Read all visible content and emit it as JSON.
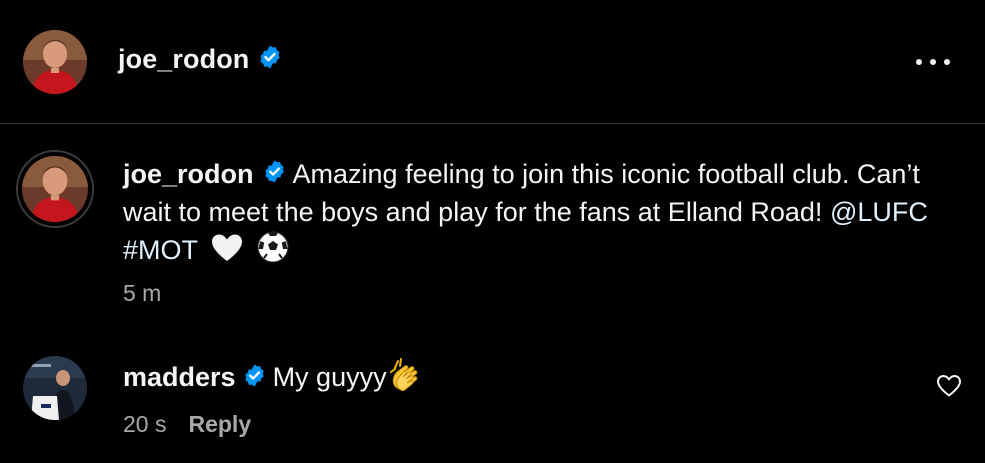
{
  "header": {
    "username": "joe_rodon",
    "avatar": "profile-photo-red-kit",
    "more_icon": "more-horizontal-icon"
  },
  "post": {
    "username": "joe_rodon",
    "caption_text": "Amazing feeling to join this iconic football club. Can’t wait to meet the boys and play for the fans at Elland Road!",
    "mention": "@LUFC",
    "hashtag": "#MOT",
    "emojis": [
      "white-heart-emoji",
      "soccer-ball-emoji"
    ],
    "timestamp": "5 m"
  },
  "comment": {
    "username": "madders",
    "text": "My guyyy",
    "emoji": "clapping-hands-emoji",
    "timestamp": "20 s",
    "reply_label": "Reply",
    "like_icon": "heart-outline-icon"
  },
  "colors": {
    "background": "#000000",
    "text_primary": "#f5f5f5",
    "text_secondary": "#a8a8a8",
    "link": "#e0f1ff",
    "verified_badge": "#0095f6",
    "divider": "#363636"
  }
}
